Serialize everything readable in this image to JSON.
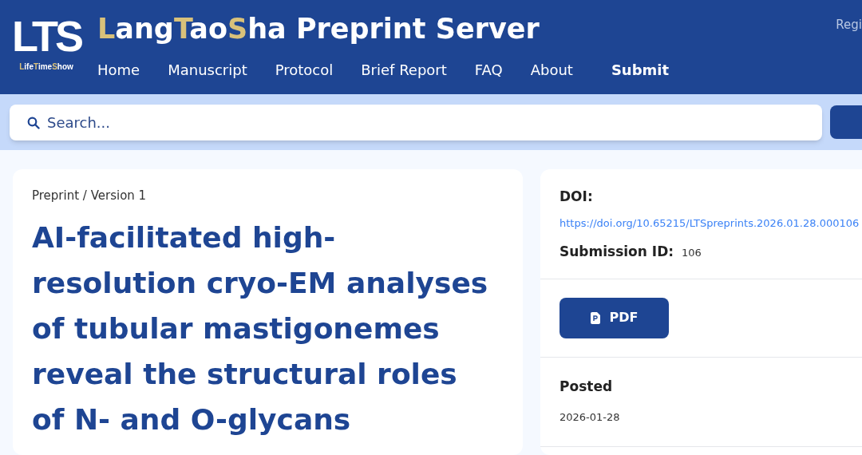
{
  "logo": {
    "mark": "LTS",
    "tagline": [
      {
        "text": "L",
        "accent": true
      },
      {
        "text": "ife",
        "accent": false
      },
      {
        "text": "T",
        "accent": true
      },
      {
        "text": "ime",
        "accent": false
      },
      {
        "text": "S",
        "accent": true
      },
      {
        "text": "how",
        "accent": false
      }
    ]
  },
  "site_title": [
    {
      "text": "L",
      "accent": true
    },
    {
      "text": "ang",
      "accent": false
    },
    {
      "text": "T",
      "accent": true
    },
    {
      "text": "ao",
      "accent": false
    },
    {
      "text": "S",
      "accent": true
    },
    {
      "text": "ha Preprint Server",
      "accent": false
    }
  ],
  "nav": [
    {
      "label": "Home",
      "emphasized": false
    },
    {
      "label": "Manuscript",
      "emphasized": false
    },
    {
      "label": "Protocol",
      "emphasized": false
    },
    {
      "label": "Brief Report",
      "emphasized": false
    },
    {
      "label": "FAQ",
      "emphasized": false
    },
    {
      "label": "About",
      "emphasized": false
    },
    {
      "label": "Submit",
      "emphasized": true
    }
  ],
  "header_link": "Regi",
  "search": {
    "placeholder": "Search..."
  },
  "article": {
    "breadcrumb": "Preprint / Version 1",
    "title": "AI-facilitated high-resolution cryo-EM analyses of tubular mastigonemes reveal the structural roles of N- and O-glycans"
  },
  "sidebar": {
    "doi_label": "DOI:",
    "doi_link": "https://doi.org/10.65215/LTSpreprints.2026.01.28.000106",
    "submission_label": "Submission ID:",
    "submission_id": "106",
    "pdf_button": "PDF",
    "posted_label": "Posted",
    "posted_date": "2026-01-28"
  }
}
